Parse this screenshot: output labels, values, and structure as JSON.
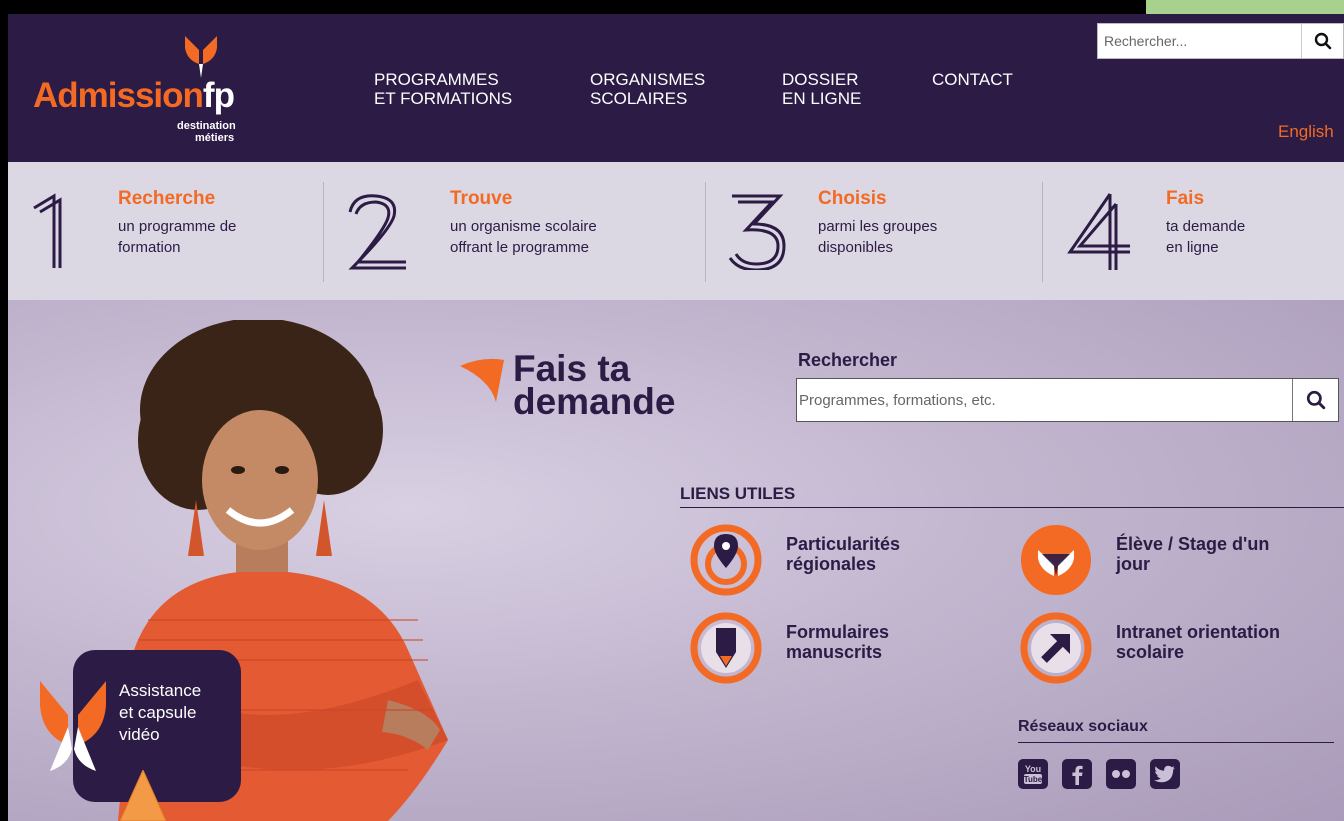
{
  "header": {
    "logo": {
      "word_main": "Admission",
      "word_accent": "fp",
      "tagline_1": "destination",
      "tagline_2": "métiers"
    },
    "nav": [
      {
        "line1": "PROGRAMMES",
        "line2": "ET FORMATIONS"
      },
      {
        "line1": "ORGANISMES",
        "line2": "SCOLAIRES"
      },
      {
        "line1": "DOSSIER",
        "line2": "EN LIGNE"
      },
      {
        "line1": "CONTACT",
        "line2": ""
      }
    ],
    "search_placeholder": "Rechercher...",
    "language": "English"
  },
  "steps": [
    {
      "number": "1",
      "title": "Recherche",
      "desc1": "un programme de",
      "desc2": "formation"
    },
    {
      "number": "2",
      "title": "Trouve",
      "desc1": "un organisme scolaire",
      "desc2": "offrant le programme"
    },
    {
      "number": "3",
      "title": "Choisis",
      "desc1": "parmi les groupes",
      "desc2": "disponibles"
    },
    {
      "number": "4",
      "title": "Fais",
      "desc1": "ta demande",
      "desc2": "en ligne"
    }
  ],
  "hero": {
    "cta_line1": "Fais ta",
    "cta_line2": "demande",
    "search_label": "Rechercher",
    "search_placeholder": "Programmes, formations, etc.",
    "useful_title": "LIENS UTILES",
    "links": [
      {
        "line1": "Particularités",
        "line2": "régionales",
        "icon": "map-pin-icon"
      },
      {
        "line1": "Élève / Stage d'un",
        "line2": "jour",
        "icon": "butterfly-icon"
      },
      {
        "line1": "Formulaires",
        "line2": "manuscrits",
        "icon": "pencil-icon"
      },
      {
        "line1": "Intranet orientation",
        "line2": "scolaire",
        "icon": "arrow-icon"
      }
    ],
    "social_title": "Réseaux sociaux",
    "social": [
      "youtube-icon",
      "facebook-icon",
      "flickr-icon",
      "twitter-icon"
    ],
    "assist_line1": "Assistance",
    "assist_line2": "et capsule",
    "assist_line3": "vidéo"
  },
  "colors": {
    "primary": "#2b1b45",
    "accent": "#f26a24",
    "band": "#dcd8e3"
  }
}
